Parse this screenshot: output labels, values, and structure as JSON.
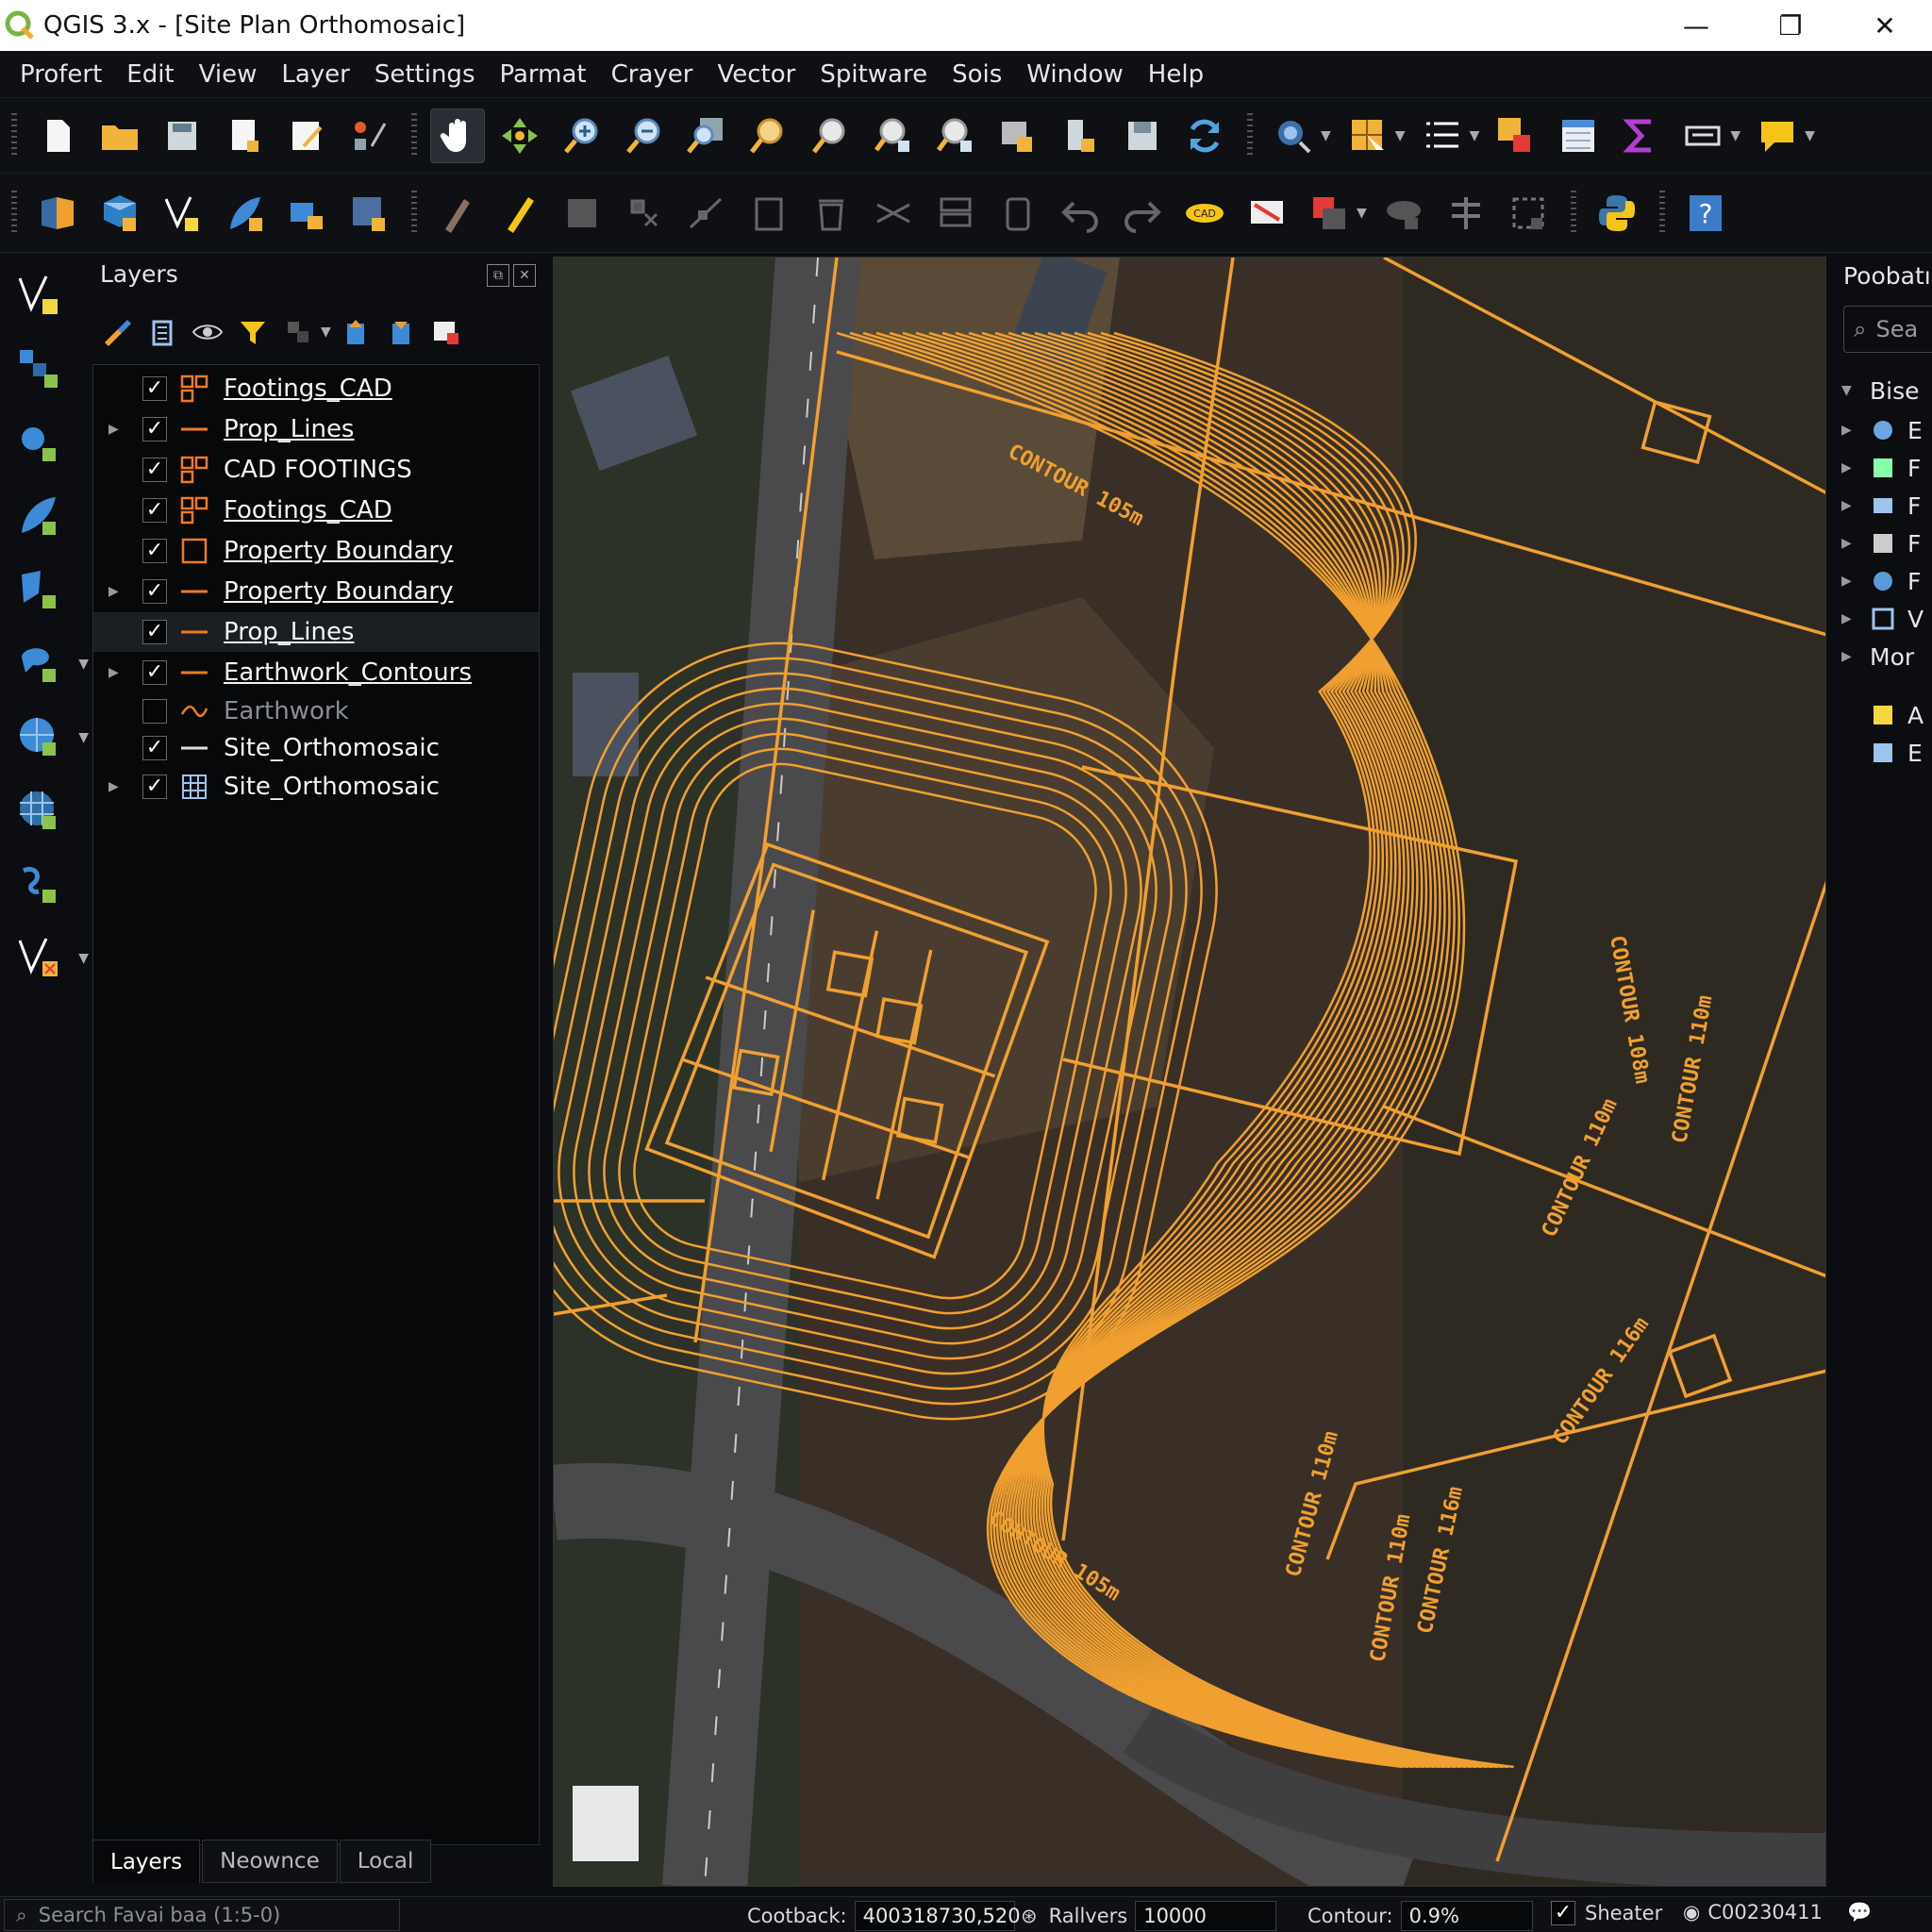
{
  "window": {
    "title": "QGIS 3.x - [Site Plan Orthomosaic]",
    "controls": [
      "—",
      "❐",
      "✕"
    ]
  },
  "menu": [
    "Profert",
    "Edit",
    "View",
    "Layer",
    "Settings",
    "Parmat",
    "Crayer",
    "Vector",
    "Spitware",
    "Sois",
    "Window",
    "Help"
  ],
  "layers_panel": {
    "title": "Layers",
    "layers": [
      {
        "name": "Footings_CAD",
        "checked": true,
        "icon": "polygon-outline-icon",
        "expandable": false
      },
      {
        "name": "Prop_Lines",
        "checked": true,
        "icon": "line-icon",
        "expandable": true
      },
      {
        "name": "CAD FOOTINGS",
        "checked": true,
        "icon": "polygon-outline-icon",
        "expandable": false
      },
      {
        "name": "Footings_CAD",
        "checked": true,
        "icon": "polygon-outline-icon",
        "expandable": false
      },
      {
        "name": "Property Boundary",
        "checked": true,
        "icon": "square-outline-icon",
        "expandable": false
      },
      {
        "name": "Property Boundary",
        "checked": true,
        "icon": "line-icon",
        "expandable": true
      },
      {
        "name": "Prop_Lines",
        "checked": true,
        "icon": "line-icon",
        "expandable": false,
        "selected": true
      },
      {
        "name": "Earthwork_Contours",
        "checked": true,
        "icon": "line-icon",
        "expandable": true
      },
      {
        "name": "Earthwork",
        "checked": false,
        "icon": "wave-icon",
        "expandable": false
      },
      {
        "name": "Site_Orthomosaic",
        "checked": true,
        "icon": "white-line-icon",
        "expandable": false
      },
      {
        "name": "Site_Orthomosaic",
        "checked": true,
        "icon": "raster-icon",
        "expandable": true
      }
    ],
    "tabs": [
      "Layers",
      "Neownce",
      "Local"
    ]
  },
  "map": {
    "labels": [
      "CONTOUR 105m",
      "CONTOUR 105m",
      "CONTOUR 108m",
      "CONTOUR 110m",
      "CONTOUR 110m",
      "CONTOUR 110m",
      "CONTOUR 110m",
      "CONTOUR 116m",
      "CONTOUR 116m"
    ],
    "colors": {
      "contour": "#f0a030",
      "ground": "#3a2f26",
      "road": "#4a4a4c"
    }
  },
  "browser_panel": {
    "title": "Poobatı",
    "search_placeholder": "Sea",
    "root": "Bise",
    "items": [
      "E",
      "F",
      "F",
      "F",
      "F",
      "V"
    ],
    "more": "Mor",
    "extras": [
      "A",
      "E"
    ]
  },
  "status": {
    "search_placeholder": "Search Favai baa (1:5-0)",
    "coord_label": "Cootback:",
    "coord_value": "400318730,520",
    "scale_label": "Rallvers",
    "scale_value": "10000",
    "contour_label": "Contour:",
    "contour_value": "0.9%",
    "render_label": "Sheater",
    "epsg": "C00230411"
  }
}
